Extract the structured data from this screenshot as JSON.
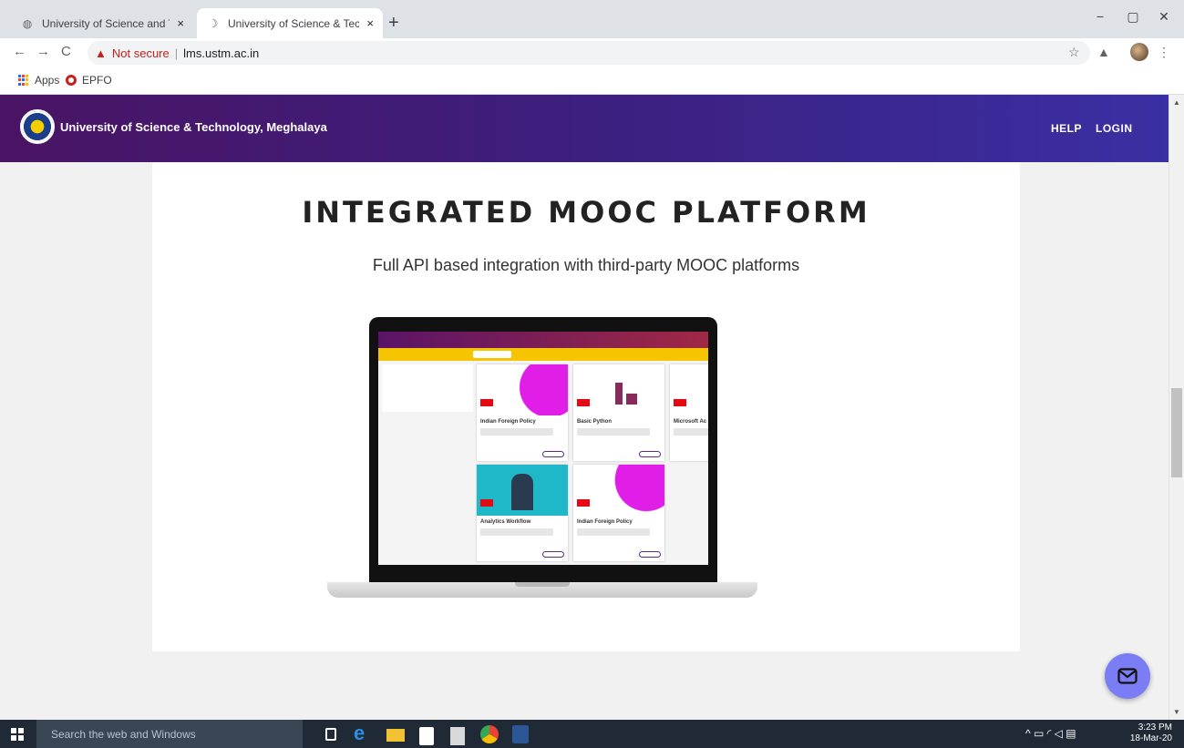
{
  "browser": {
    "tabs": [
      {
        "title": "University of Science and Techno",
        "active": false
      },
      {
        "title": "University of Science & Technolo",
        "active": true
      }
    ],
    "close_glyph": "×",
    "new_tab_glyph": "+",
    "window_buttons": {
      "minimize": "−",
      "maximize": "▢",
      "close": "✕"
    },
    "nav": {
      "back": "←",
      "forward": "→",
      "reload": "C"
    },
    "address": {
      "security_label": "Not secure",
      "url": "lms.ustm.ac.in"
    },
    "bookmarks": [
      {
        "label": "Apps",
        "icon": "apps-grid-icon"
      },
      {
        "label": "EPFO",
        "icon": "epfo-icon"
      }
    ]
  },
  "site": {
    "title": "University of Science & Technology, Meghalaya",
    "nav": {
      "help": "HELP",
      "login": "LOGIN"
    },
    "brand_gradient": [
      "#4a1464",
      "#3a2fa3"
    ]
  },
  "section": {
    "heading": "INTEGRATED MOOC PLATFORM",
    "subheading": "Full API based integration with third-party MOOC platforms"
  },
  "mockup": {
    "courses": [
      {
        "title": "Indian Foreign Policy"
      },
      {
        "title": "Basic Python"
      },
      {
        "title": "Microsoft Ac"
      },
      {
        "title": "Analytics Workflow"
      },
      {
        "title": "Indian Foreign Policy"
      }
    ]
  },
  "taskbar": {
    "search_placeholder": "Search the web and Windows",
    "time": "3:23 PM",
    "date": "18-Mar-20"
  },
  "colors": {
    "accent": "#7b7df5",
    "taskbar": "#1f2a36",
    "warning": "#c5221f"
  }
}
